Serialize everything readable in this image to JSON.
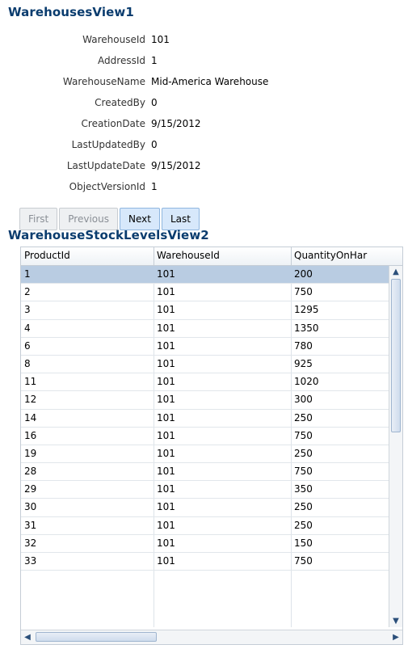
{
  "section1": {
    "title": "WarehousesView1",
    "fields": [
      {
        "label": "WarehouseId",
        "value": "101"
      },
      {
        "label": "AddressId",
        "value": "1"
      },
      {
        "label": "WarehouseName",
        "value": "Mid-America Warehouse"
      },
      {
        "label": "CreatedBy",
        "value": "0"
      },
      {
        "label": "CreationDate",
        "value": "9/15/2012"
      },
      {
        "label": "LastUpdatedBy",
        "value": "0"
      },
      {
        "label": "LastUpdateDate",
        "value": "9/15/2012"
      },
      {
        "label": "ObjectVersionId",
        "value": "1"
      }
    ],
    "nav": {
      "first": "First",
      "previous": "Previous",
      "next": "Next",
      "last": "Last"
    }
  },
  "section2": {
    "title": "WarehouseStockLevelsView2",
    "columns": [
      "ProductId",
      "WarehouseId",
      "QuantityOnHar"
    ],
    "rows": [
      [
        "1",
        "101",
        "200"
      ],
      [
        "2",
        "101",
        "750"
      ],
      [
        "3",
        "101",
        "1295"
      ],
      [
        "4",
        "101",
        "1350"
      ],
      [
        "6",
        "101",
        "780"
      ],
      [
        "8",
        "101",
        "925"
      ],
      [
        "11",
        "101",
        "1020"
      ],
      [
        "12",
        "101",
        "300"
      ],
      [
        "14",
        "101",
        "250"
      ],
      [
        "16",
        "101",
        "750"
      ],
      [
        "19",
        "101",
        "250"
      ],
      [
        "28",
        "101",
        "750"
      ],
      [
        "29",
        "101",
        "350"
      ],
      [
        "30",
        "101",
        "250"
      ],
      [
        "31",
        "101",
        "250"
      ],
      [
        "32",
        "101",
        "150"
      ],
      [
        "33",
        "101",
        "750"
      ]
    ]
  }
}
